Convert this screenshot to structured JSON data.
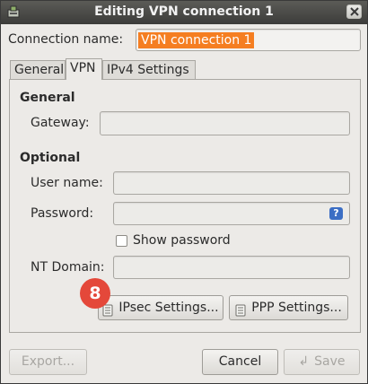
{
  "window": {
    "title": "Editing VPN connection 1"
  },
  "connection": {
    "label": "Connection name:",
    "value": "VPN connection 1"
  },
  "tabs": [
    {
      "label": "General"
    },
    {
      "label": "VPN"
    },
    {
      "label": "IPv4 Settings"
    }
  ],
  "vpn": {
    "general_heading": "General",
    "gateway_label": "Gateway:",
    "gateway_value": "",
    "optional_heading": "Optional",
    "username_label": "User name:",
    "username_value": "",
    "password_label": "Password:",
    "password_value": "",
    "show_password_label": "Show password",
    "show_password_checked": false,
    "ntdomain_label": "NT Domain:",
    "ntdomain_value": "",
    "ipsec_button": "IPsec Settings...",
    "ppp_button": "PPP Settings..."
  },
  "annotation": {
    "badge": "8"
  },
  "footer": {
    "export": "Export...",
    "cancel": "Cancel",
    "save": "Save"
  },
  "icons": {
    "help": "?",
    "app": "network-icon",
    "close": "close-icon"
  },
  "colors": {
    "selection": "#f57e21",
    "badge": "#e4483a",
    "help": "#3b6ec4"
  }
}
